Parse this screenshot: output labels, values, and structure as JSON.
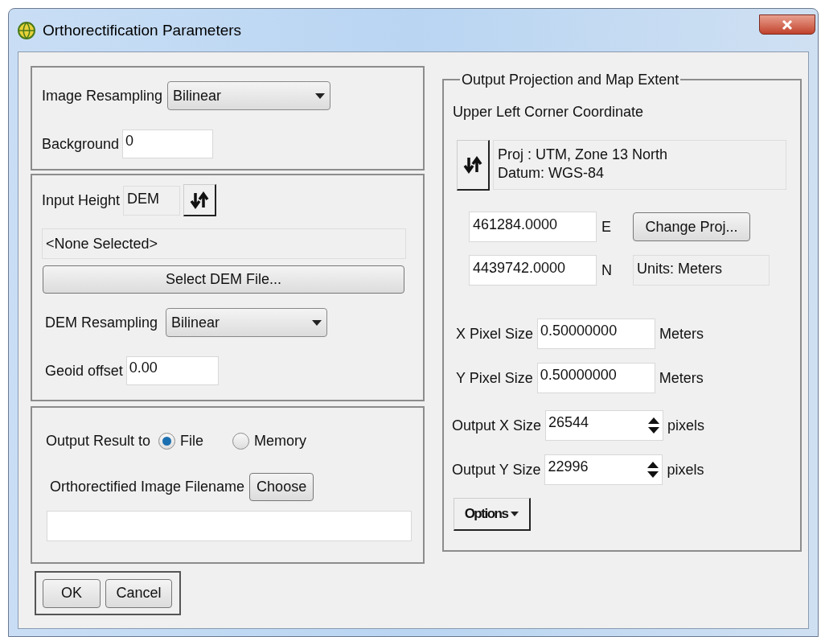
{
  "window": {
    "title": "Orthorectification Parameters"
  },
  "image_resampling": {
    "label": "Image Resampling",
    "value": "Bilinear"
  },
  "background": {
    "label": "Background",
    "value": "0"
  },
  "input_height": {
    "label": "Input Height",
    "value": "DEM"
  },
  "dem_file": {
    "value": "<None Selected>",
    "button": "Select DEM File..."
  },
  "dem_resampling": {
    "label": "DEM Resampling",
    "value": "Bilinear"
  },
  "geoid_offset": {
    "label": "Geoid offset",
    "value": "0.00"
  },
  "output_result": {
    "label": "Output Result to",
    "options": [
      {
        "label": "File",
        "selected": true
      },
      {
        "label": "Memory",
        "selected": false
      }
    ]
  },
  "output_filename": {
    "label": "Orthorectified Image Filename",
    "button": "Choose"
  },
  "buttons": [
    "OK",
    "Cancel"
  ],
  "projection": {
    "title": "Output Projection and Map Extent",
    "subtitle": "Upper Left Corner Coordinate",
    "info": [
      "Proj : UTM, Zone 13 North",
      "Datum: WGS-84"
    ],
    "easting": {
      "value": "461284.0000",
      "unit": "E"
    },
    "northing": {
      "value": "4439742.0000",
      "unit": "N"
    },
    "change_button": "Change Proj...",
    "units": "Units: Meters",
    "pixel_sizes": [
      {
        "label": "X Pixel Size",
        "value": "0.50000000",
        "unit": "Meters"
      },
      {
        "label": "Y Pixel Size",
        "value": "0.50000000",
        "unit": "Meters"
      }
    ],
    "output_sizes": [
      {
        "label": "Output X Size",
        "value": "26544",
        "unit": "pixels"
      },
      {
        "label": "Output Y Size",
        "value": "22996",
        "unit": "pixels"
      }
    ],
    "options_button": "Options"
  }
}
